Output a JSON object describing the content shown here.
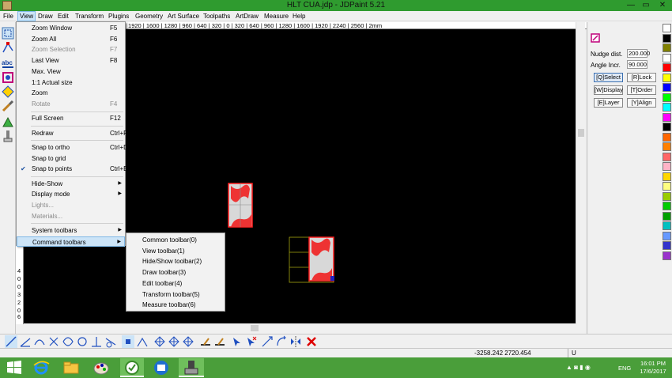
{
  "window": {
    "title": "HLT CUA.jdp - JDPaint 5.21",
    "minimize": "—",
    "restore": "▭",
    "close": "✕"
  },
  "menubar": [
    "File",
    "View",
    "Draw",
    "Edit",
    "Transform",
    "Plugins",
    "Geometry",
    "Art Surface",
    "Toolpaths",
    "ArtDraw",
    "Measure",
    "Help"
  ],
  "view_menu": [
    {
      "label": "Zoom Window",
      "shortcut": "F5"
    },
    {
      "label": "Zoom All",
      "shortcut": "F6"
    },
    {
      "label": "Zoom Selection",
      "shortcut": "F7",
      "disabled": true
    },
    {
      "label": "Last View",
      "shortcut": "F8"
    },
    {
      "label": "Max. View",
      "shortcut": ""
    },
    {
      "label": "1:1 Actual size",
      "shortcut": ""
    },
    {
      "label": "Zoom",
      "shortcut": ""
    },
    {
      "label": "Rotate",
      "shortcut": "F4",
      "disabled": true
    },
    {
      "label": "Full Screen",
      "shortcut": "F12"
    },
    {
      "label": "Redraw",
      "shortcut": "Ctrl+R"
    },
    {
      "label": "Snap to ortho",
      "shortcut": "Ctrl+D"
    },
    {
      "label": "Snap to grid",
      "shortcut": ""
    },
    {
      "label": "Snap to points",
      "shortcut": "Ctrl+E",
      "checked": true
    },
    {
      "label": "Hide-Show",
      "shortcut": "",
      "submenu": true
    },
    {
      "label": "Display mode",
      "shortcut": "",
      "submenu": true
    },
    {
      "label": "Lights...",
      "shortcut": "",
      "disabled": true
    },
    {
      "label": "Materials...",
      "shortcut": "",
      "disabled": true
    },
    {
      "label": "System toolbars",
      "shortcut": "",
      "submenu": true
    },
    {
      "label": "Command toolbars",
      "shortcut": "",
      "submenu": true,
      "highlighted": true
    }
  ],
  "command_toolbars_submenu": [
    "Common toolbar(0)",
    "View toolbar(1)",
    "Hide/Show toolbar(2)",
    "Draw toolbar(3)",
    "Edit toolbar(4)",
    "Transform toolbar(5)",
    "Measure toolbar(6)"
  ],
  "ruler_top": "| 1920 | 1600 | 1280 | 960 | 640 | 320 | 0 | 320 | 640 | 960 | 1280 | 1600 | 1920 | 2240 | 2560 | 2mm",
  "ruler_left": [
    "4",
    "0",
    "0",
    "3",
    "2",
    "0",
    "6",
    "4",
    "0"
  ],
  "right_panel": {
    "nudge_label": "Nudge dist.",
    "nudge_value": "200.000",
    "angle_label": "Angle Incr.",
    "angle_value": "90.000",
    "buttons": [
      "[Q]Select",
      "[R]Lock",
      "[W]Display",
      "[T]Order",
      "[E]Layer",
      "[Y]Align"
    ]
  },
  "palette_colors": [
    "#ffffff",
    "#000000",
    "#808000",
    "#ffffff",
    "#ff0000",
    "#ffff00",
    "#0000ff",
    "#00ff00",
    "#00ffff",
    "#ff00ff",
    "#000000",
    "#ff6600",
    "#ff8000",
    "#ff6666",
    "#ffb3c6",
    "#ffd700",
    "#ffff80",
    "#99cc00",
    "#00cc00",
    "#00a000",
    "#00c0c0",
    "#6699ff",
    "#3333cc",
    "#9933cc"
  ],
  "status": {
    "coords": "-3258.242 2720.454",
    "mode": "U"
  },
  "taskbar": {
    "lang": "ENG",
    "time": "16:01 PM",
    "date": "17/6/2017"
  },
  "colors": {
    "titlebar": "#2f9b2f",
    "taskbar": "#4a9e3a",
    "canvas": "#000000",
    "menu_highlight": "#cce4f7"
  }
}
